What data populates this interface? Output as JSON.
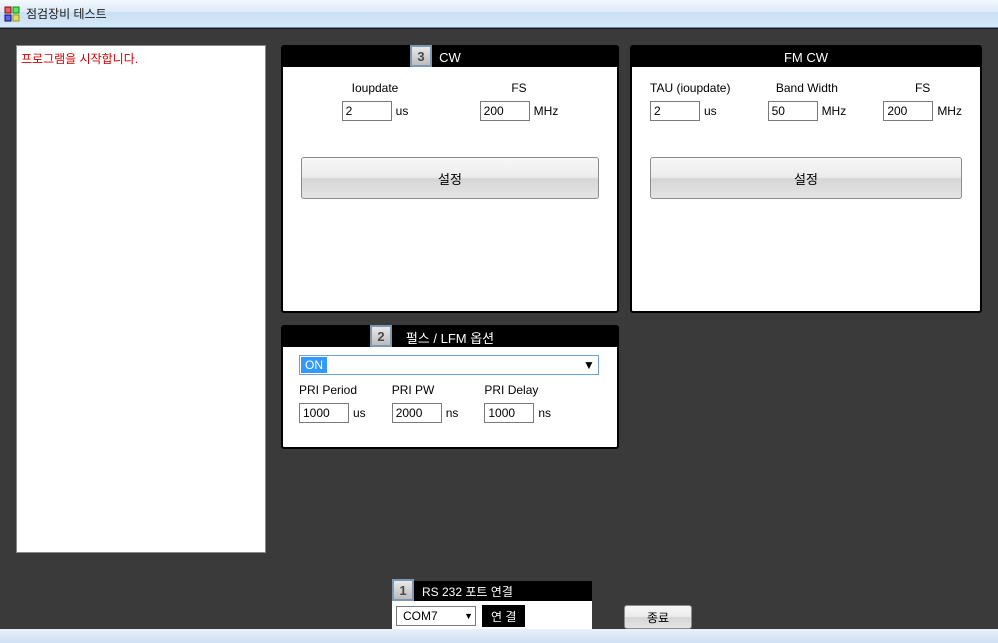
{
  "window": {
    "title": "점검장비 테스트"
  },
  "log": {
    "message": "프로그램을 시작합니다."
  },
  "cw": {
    "badge": "3",
    "title": "CW",
    "ioupdate": {
      "label": "Ioupdate",
      "value": "2",
      "unit": "us"
    },
    "fs": {
      "label": "FS",
      "value": "200",
      "unit": "MHz"
    },
    "button": "설정"
  },
  "fmcw": {
    "title": "FM CW",
    "tau": {
      "label": "TAU (ioupdate)",
      "value": "2",
      "unit": "us"
    },
    "bw": {
      "label": "Band Width",
      "value": "50",
      "unit": "MHz"
    },
    "fs": {
      "label": "FS",
      "value": "200",
      "unit": "MHz"
    },
    "button": "설정"
  },
  "pulse": {
    "badge": "2",
    "title": "펄스 / LFM 옵션",
    "mode": "ON",
    "pri_period": {
      "label": "PRI Period",
      "value": "1000",
      "unit": "us"
    },
    "pri_pw": {
      "label": "PRI PW",
      "value": "2000",
      "unit": "ns"
    },
    "pri_delay": {
      "label": "PRI Delay",
      "value": "1000",
      "unit": "ns"
    }
  },
  "port": {
    "badge": "1",
    "title": "RS 232 포트 연결",
    "selected": "COM7",
    "connect": "연 결"
  },
  "exit": {
    "label": "종료"
  }
}
